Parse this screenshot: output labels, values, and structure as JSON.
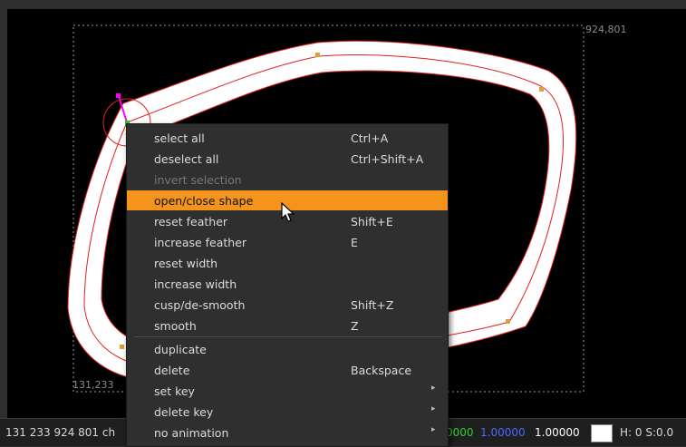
{
  "viewer": {
    "bbox_label_top_right": "924,801",
    "bbox_label_bottom_left": "131,233"
  },
  "status_bar": {
    "coords_text": "131 233 924 801 ch",
    "value_green": "0000",
    "value_blue": "1.00000",
    "value_white": "1.00000",
    "hs_text": "H:  0 S:0.0",
    "swatch_color": "#ffffff"
  },
  "context_menu": {
    "items": [
      {
        "label": "select all",
        "shortcut": "Ctrl+A"
      },
      {
        "label": "deselect all",
        "shortcut": "Ctrl+Shift+A"
      },
      {
        "label": "invert selection",
        "shortcut": "",
        "disabled": true
      },
      {
        "label": "open/close shape",
        "shortcut": "",
        "highlighted": true
      },
      {
        "label": "reset feather",
        "shortcut": "Shift+E"
      },
      {
        "label": "increase feather",
        "shortcut": "E"
      },
      {
        "label": "reset width",
        "shortcut": ""
      },
      {
        "label": "increase width",
        "shortcut": ""
      },
      {
        "label": "cusp/de-smooth",
        "shortcut": "Shift+Z"
      },
      {
        "label": "smooth",
        "shortcut": "Z"
      },
      {
        "label": "duplicate",
        "shortcut": ""
      },
      {
        "label": "delete",
        "shortcut": "Backspace"
      },
      {
        "label": "set key",
        "shortcut": "",
        "submenu": true
      },
      {
        "label": "delete key",
        "shortcut": "",
        "submenu": true
      },
      {
        "label": "no animation",
        "shortcut": "",
        "submenu": true
      }
    ]
  },
  "colors": {
    "highlight": "#f4941c",
    "stroke_outline": "#e02020",
    "canvas": "#000000",
    "tangent_handle": "#ff00ff",
    "control_point": "#d9a13a"
  },
  "icons": [
    "mouse-cursor-icon",
    "submenu-arrow-icon"
  ]
}
